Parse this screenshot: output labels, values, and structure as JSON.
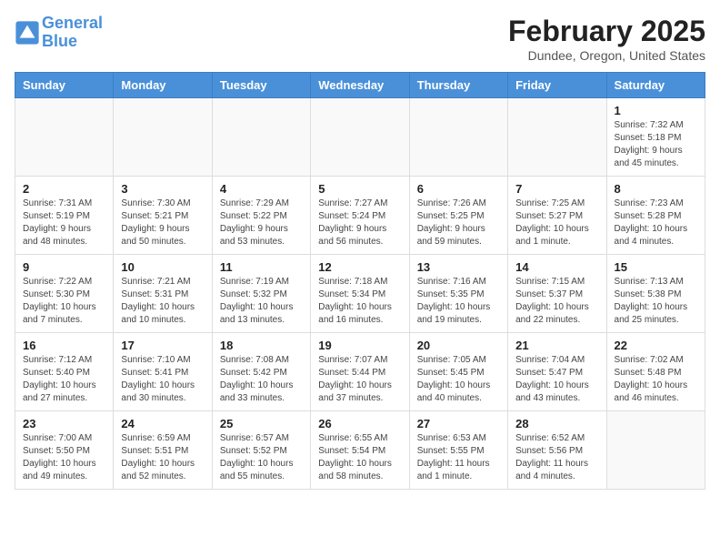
{
  "header": {
    "logo_line1": "General",
    "logo_line2": "Blue",
    "title": "February 2025",
    "subtitle": "Dundee, Oregon, United States"
  },
  "days_of_week": [
    "Sunday",
    "Monday",
    "Tuesday",
    "Wednesday",
    "Thursday",
    "Friday",
    "Saturday"
  ],
  "weeks": [
    [
      {
        "day": "",
        "info": ""
      },
      {
        "day": "",
        "info": ""
      },
      {
        "day": "",
        "info": ""
      },
      {
        "day": "",
        "info": ""
      },
      {
        "day": "",
        "info": ""
      },
      {
        "day": "",
        "info": ""
      },
      {
        "day": "1",
        "info": "Sunrise: 7:32 AM\nSunset: 5:18 PM\nDaylight: 9 hours and 45 minutes."
      }
    ],
    [
      {
        "day": "2",
        "info": "Sunrise: 7:31 AM\nSunset: 5:19 PM\nDaylight: 9 hours and 48 minutes."
      },
      {
        "day": "3",
        "info": "Sunrise: 7:30 AM\nSunset: 5:21 PM\nDaylight: 9 hours and 50 minutes."
      },
      {
        "day": "4",
        "info": "Sunrise: 7:29 AM\nSunset: 5:22 PM\nDaylight: 9 hours and 53 minutes."
      },
      {
        "day": "5",
        "info": "Sunrise: 7:27 AM\nSunset: 5:24 PM\nDaylight: 9 hours and 56 minutes."
      },
      {
        "day": "6",
        "info": "Sunrise: 7:26 AM\nSunset: 5:25 PM\nDaylight: 9 hours and 59 minutes."
      },
      {
        "day": "7",
        "info": "Sunrise: 7:25 AM\nSunset: 5:27 PM\nDaylight: 10 hours and 1 minute."
      },
      {
        "day": "8",
        "info": "Sunrise: 7:23 AM\nSunset: 5:28 PM\nDaylight: 10 hours and 4 minutes."
      }
    ],
    [
      {
        "day": "9",
        "info": "Sunrise: 7:22 AM\nSunset: 5:30 PM\nDaylight: 10 hours and 7 minutes."
      },
      {
        "day": "10",
        "info": "Sunrise: 7:21 AM\nSunset: 5:31 PM\nDaylight: 10 hours and 10 minutes."
      },
      {
        "day": "11",
        "info": "Sunrise: 7:19 AM\nSunset: 5:32 PM\nDaylight: 10 hours and 13 minutes."
      },
      {
        "day": "12",
        "info": "Sunrise: 7:18 AM\nSunset: 5:34 PM\nDaylight: 10 hours and 16 minutes."
      },
      {
        "day": "13",
        "info": "Sunrise: 7:16 AM\nSunset: 5:35 PM\nDaylight: 10 hours and 19 minutes."
      },
      {
        "day": "14",
        "info": "Sunrise: 7:15 AM\nSunset: 5:37 PM\nDaylight: 10 hours and 22 minutes."
      },
      {
        "day": "15",
        "info": "Sunrise: 7:13 AM\nSunset: 5:38 PM\nDaylight: 10 hours and 25 minutes."
      }
    ],
    [
      {
        "day": "16",
        "info": "Sunrise: 7:12 AM\nSunset: 5:40 PM\nDaylight: 10 hours and 27 minutes."
      },
      {
        "day": "17",
        "info": "Sunrise: 7:10 AM\nSunset: 5:41 PM\nDaylight: 10 hours and 30 minutes."
      },
      {
        "day": "18",
        "info": "Sunrise: 7:08 AM\nSunset: 5:42 PM\nDaylight: 10 hours and 33 minutes."
      },
      {
        "day": "19",
        "info": "Sunrise: 7:07 AM\nSunset: 5:44 PM\nDaylight: 10 hours and 37 minutes."
      },
      {
        "day": "20",
        "info": "Sunrise: 7:05 AM\nSunset: 5:45 PM\nDaylight: 10 hours and 40 minutes."
      },
      {
        "day": "21",
        "info": "Sunrise: 7:04 AM\nSunset: 5:47 PM\nDaylight: 10 hours and 43 minutes."
      },
      {
        "day": "22",
        "info": "Sunrise: 7:02 AM\nSunset: 5:48 PM\nDaylight: 10 hours and 46 minutes."
      }
    ],
    [
      {
        "day": "23",
        "info": "Sunrise: 7:00 AM\nSunset: 5:50 PM\nDaylight: 10 hours and 49 minutes."
      },
      {
        "day": "24",
        "info": "Sunrise: 6:59 AM\nSunset: 5:51 PM\nDaylight: 10 hours and 52 minutes."
      },
      {
        "day": "25",
        "info": "Sunrise: 6:57 AM\nSunset: 5:52 PM\nDaylight: 10 hours and 55 minutes."
      },
      {
        "day": "26",
        "info": "Sunrise: 6:55 AM\nSunset: 5:54 PM\nDaylight: 10 hours and 58 minutes."
      },
      {
        "day": "27",
        "info": "Sunrise: 6:53 AM\nSunset: 5:55 PM\nDaylight: 11 hours and 1 minute."
      },
      {
        "day": "28",
        "info": "Sunrise: 6:52 AM\nSunset: 5:56 PM\nDaylight: 11 hours and 4 minutes."
      },
      {
        "day": "",
        "info": ""
      }
    ]
  ]
}
